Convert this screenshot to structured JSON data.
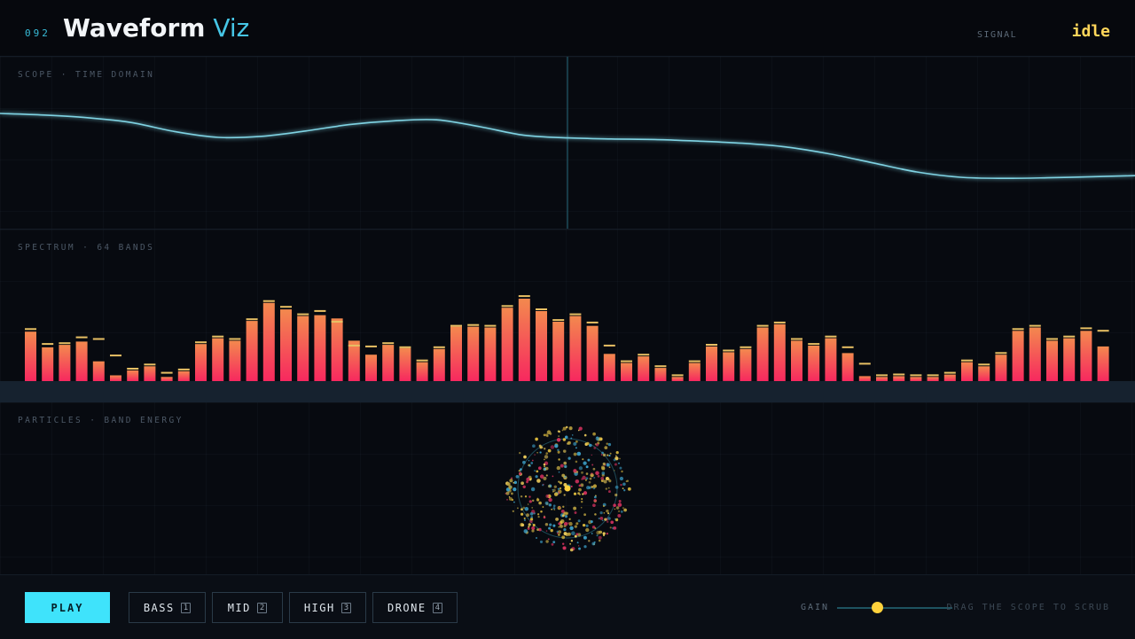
{
  "header": {
    "index": "092",
    "title_main": "Waveform",
    "title_accent": "Viz",
    "signal_label": "SIGNAL",
    "signal_value": "idle"
  },
  "scope": {
    "label": "SCOPE · TIME DOMAIN",
    "wave_color": "#7fd3e3",
    "playhead_color": "#1d4a58",
    "playhead_position": 0.5,
    "wave_samples": [
      0.55,
      0.52,
      0.47,
      0.38,
      0.21,
      0.1,
      0.12,
      0.22,
      0.34,
      0.41,
      0.43,
      0.3,
      0.14,
      0.09,
      0.07,
      0.06,
      0.03,
      -0.01,
      -0.08,
      -0.21,
      -0.38,
      -0.55,
      -0.65,
      -0.67,
      -0.66,
      -0.64,
      -0.62
    ]
  },
  "spectrum": {
    "label": "SPECTRUM · 64 BANDS",
    "bar_color_top": "#f3894e",
    "bar_color_bottom": "#f7285f",
    "peak_color": "#e8c064",
    "bands": [
      0.6,
      0.41,
      0.44,
      0.48,
      0.24,
      0.07,
      0.13,
      0.18,
      0.05,
      0.12,
      0.45,
      0.52,
      0.49,
      0.73,
      0.95,
      0.87,
      0.79,
      0.8,
      0.76,
      0.49,
      0.32,
      0.44,
      0.4,
      0.23,
      0.39,
      0.66,
      0.66,
      0.65,
      0.89,
      1.0,
      0.85,
      0.72,
      0.79,
      0.67,
      0.33,
      0.22,
      0.3,
      0.16,
      0.05,
      0.22,
      0.42,
      0.35,
      0.39,
      0.65,
      0.69,
      0.49,
      0.43,
      0.52,
      0.34,
      0.06,
      0.05,
      0.06,
      0.05,
      0.05,
      0.08,
      0.23,
      0.18,
      0.32,
      0.61,
      0.65,
      0.49,
      0.52,
      0.61,
      0.42
    ],
    "peaks": [
      0.62,
      0.44,
      0.45,
      0.52,
      0.5,
      0.3,
      0.14,
      0.19,
      0.09,
      0.13,
      0.46,
      0.53,
      0.5,
      0.74,
      0.96,
      0.89,
      0.8,
      0.84,
      0.71,
      0.42,
      0.41,
      0.45,
      0.4,
      0.24,
      0.4,
      0.66,
      0.67,
      0.66,
      0.9,
      1.02,
      0.86,
      0.73,
      0.8,
      0.7,
      0.42,
      0.23,
      0.31,
      0.17,
      0.06,
      0.23,
      0.43,
      0.36,
      0.4,
      0.66,
      0.7,
      0.5,
      0.44,
      0.53,
      0.4,
      0.2,
      0.06,
      0.07,
      0.06,
      0.06,
      0.09,
      0.24,
      0.19,
      0.33,
      0.62,
      0.66,
      0.5,
      0.53,
      0.63,
      0.6
    ]
  },
  "particles": {
    "label": "PARTICLES · BAND ENERGY",
    "ring_color": "#1d4a58",
    "core_color": "#ffd23c",
    "palette": [
      "#d8b63c",
      "#e8c85a",
      "#3b9cc4",
      "#d0305c",
      "#b8a040"
    ],
    "count": 420
  },
  "controls": {
    "play_label": "PLAY",
    "bands": [
      {
        "label": "BASS",
        "key": "1"
      },
      {
        "label": "MID",
        "key": "2"
      },
      {
        "label": "HIGH",
        "key": "3"
      },
      {
        "label": "DRONE",
        "key": "4"
      }
    ],
    "gain_label": "GAIN",
    "gain_value": 0.35,
    "hint": "DRAG THE SCOPE TO SCRUB"
  }
}
